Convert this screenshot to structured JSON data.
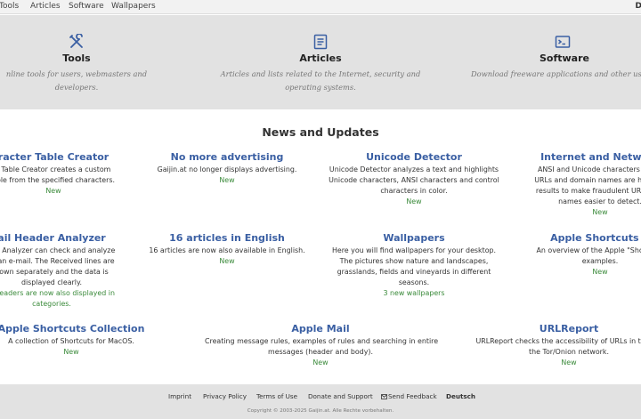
{
  "nav": {
    "links": [
      "Tools",
      "Articles",
      "Software",
      "Wallpapers"
    ],
    "right_label": "D"
  },
  "hero": {
    "accent_color": "#3a5fa3",
    "sections": [
      {
        "icon": "tools-icon",
        "title": "Tools",
        "desc": "nline tools for users, webmasters and developers."
      },
      {
        "icon": "document-icon",
        "title": "Articles",
        "desc": "Articles and lists related to the Internet, security and operating systems."
      },
      {
        "icon": "terminal-icon",
        "title": "Software",
        "desc": "Download freeware applications and other useful"
      }
    ]
  },
  "news": {
    "title": "News and Updates",
    "items": [
      {
        "title": "racter Table Creator",
        "desc": [
          "r Table Creator creates a custom",
          "able from the specified characters."
        ],
        "badge": "New"
      },
      {
        "title": "No more advertising",
        "desc": [
          "Gaijin.at no longer displays advertising."
        ],
        "badge": "New"
      },
      {
        "title": "Unicode Detector",
        "desc": [
          "Unicode Detector analyzes a text and highlights",
          "Unicode characters, ANSI characters and control",
          "characters in color."
        ],
        "badge": "New"
      },
      {
        "title": "Internet and Network",
        "desc": [
          "ANSI and Unicode characters in the",
          "URLs and domain names are highligh",
          "results to make fraudulent URLs and",
          "names easier to detect."
        ],
        "badge": "New"
      },
      {
        "title": "ail Header Analyzer",
        "desc": [
          "der Analyzer can check and analyze",
          "of an e-mail. The Received lines are",
          "down separately and the data is",
          "displayed clearly."
        ],
        "badge": "e headers are now also displayed in",
        "badge2": "categories."
      },
      {
        "title": "16 articles in English",
        "desc": [
          "16 articles are now also available in English."
        ],
        "badge": "New"
      },
      {
        "title": "Wallpapers",
        "desc": [
          "Here you will find wallpapers for your desktop.",
          "The pictures show nature and landscapes,",
          "grasslands, fields and vineyards in different",
          "seasons."
        ],
        "badge": "3 new wallpapers"
      },
      {
        "title": "Apple Shortcuts A",
        "desc": [
          "An overview of the Apple \"Shortcuts",
          "examples."
        ],
        "badge": "New"
      },
      {
        "title": "Apple Shortcuts Collection",
        "desc": [
          "A collection of Shortcuts for MacOS."
        ],
        "badge": "New"
      },
      {
        "title": "Apple Mail",
        "desc": [
          "Creating message rules, examples of rules and searching in entire",
          "messages (header and body)."
        ],
        "badge": "New"
      },
      {
        "title": "URLReport",
        "desc": [
          "URLReport checks the accessibility of URLs in the cle",
          "the Tor/Onion network."
        ],
        "badge": "New"
      }
    ]
  },
  "footer": {
    "links": [
      "Imprint",
      "Privacy Policy",
      "Terms of Use",
      "Donate and Support",
      "Send Feedback",
      "Deutsch"
    ],
    "copyright": "Copyright © 2003-2025 Gaijin.at. Alle Rechte vorbehalten."
  }
}
